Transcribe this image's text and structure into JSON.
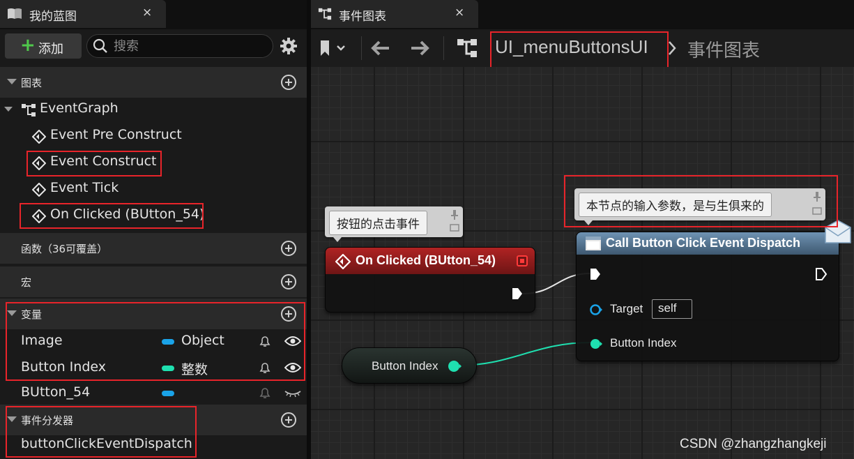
{
  "left_panel": {
    "tab_title": "我的蓝图",
    "tab_close": "×",
    "add_label": "添加",
    "search_placeholder": "搜索",
    "sections": {
      "graphs": "图表",
      "functions": "函数（36可覆盖）",
      "macros": "宏",
      "variables": "变量",
      "dispatchers": "事件分发器"
    },
    "tree": {
      "event_graph": "EventGraph",
      "events": [
        "Event Pre Construct",
        "Event Construct",
        "Event Tick",
        "On Clicked (BUtton_54)"
      ]
    },
    "variables": [
      {
        "name": "Image",
        "type": "Object",
        "color": "#1aa3e8"
      },
      {
        "name": "Button Index",
        "type": "整数",
        "color": "#1fe0b0"
      },
      {
        "name": "BUtton_54",
        "type": "",
        "color": "#1aa3e8"
      }
    ],
    "dispatchers": [
      "buttonClickEventDispatch"
    ]
  },
  "graph": {
    "tab_title": "事件图表",
    "tab_close": "×",
    "breadcrumb": [
      "UI_menuButtonsUI",
      "事件图表"
    ],
    "comments": {
      "left": "按钮的点击事件",
      "right": "本节点的输入参数，是与生俱来的"
    },
    "event_node": {
      "title": "On Clicked (BUtton_54)",
      "color": "#8c1b1b"
    },
    "call_node": {
      "title": "Call Button Click Event Dispatch",
      "color": "#5c7f9e",
      "target_label": "Target",
      "target_value": "self",
      "index_label": "Button Index"
    },
    "getter_node": {
      "label": "Button Index"
    },
    "pin_colors": {
      "exec": "#ffffff",
      "object": "#1aa3e8",
      "integer": "#1fe0b0"
    }
  },
  "watermark": "CSDN @zhangzhangkeji"
}
